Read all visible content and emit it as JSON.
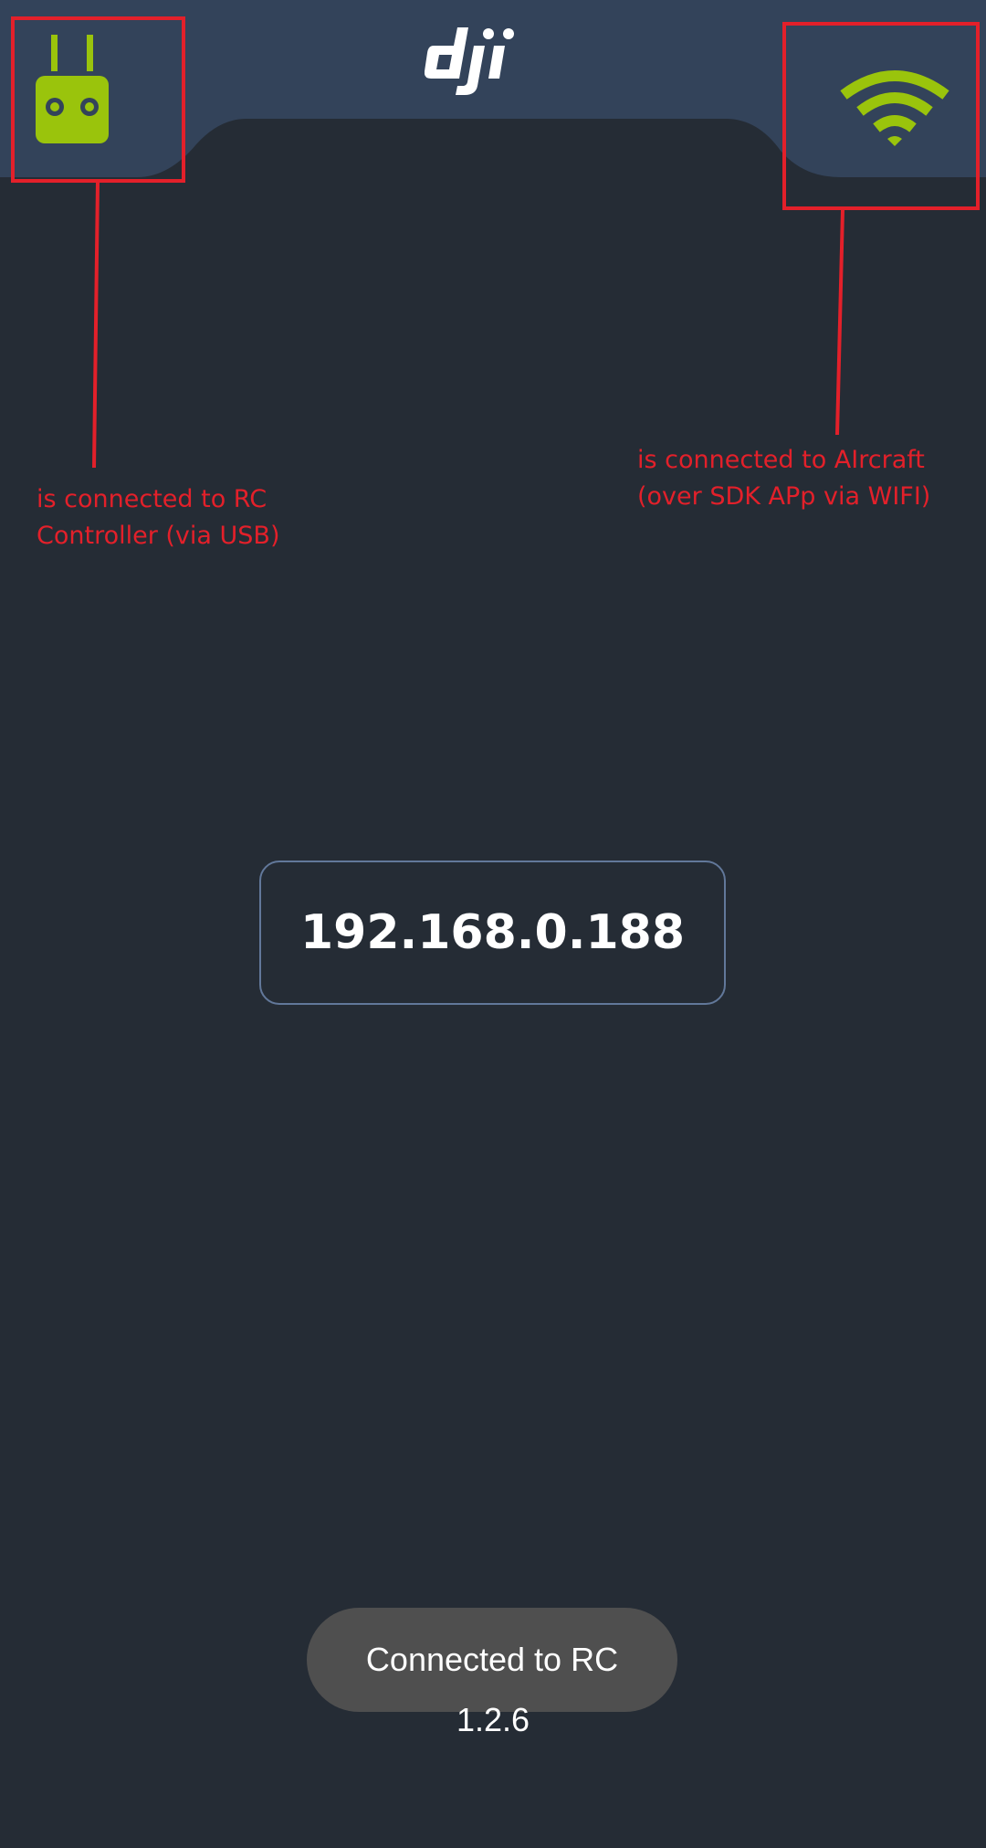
{
  "header": {
    "logo": "dji",
    "logo_icon": "dji-logo-icon",
    "rc_icon": "remote-controller-icon",
    "wifi_icon": "wifi-icon",
    "rc_status_color": "#9ac40c",
    "wifi_status_color": "#9ac40c"
  },
  "annotations": {
    "rc_note": "is connected to RC\nController (via USB)",
    "aircraft_note": "is connected to AIrcraft\n(over SDK APp via WIFI)",
    "color": "#e3202a"
  },
  "main": {
    "ip_address": "192.168.0.188"
  },
  "toast": {
    "message": "Connected to RC"
  },
  "footer": {
    "version": "1.2.6"
  }
}
